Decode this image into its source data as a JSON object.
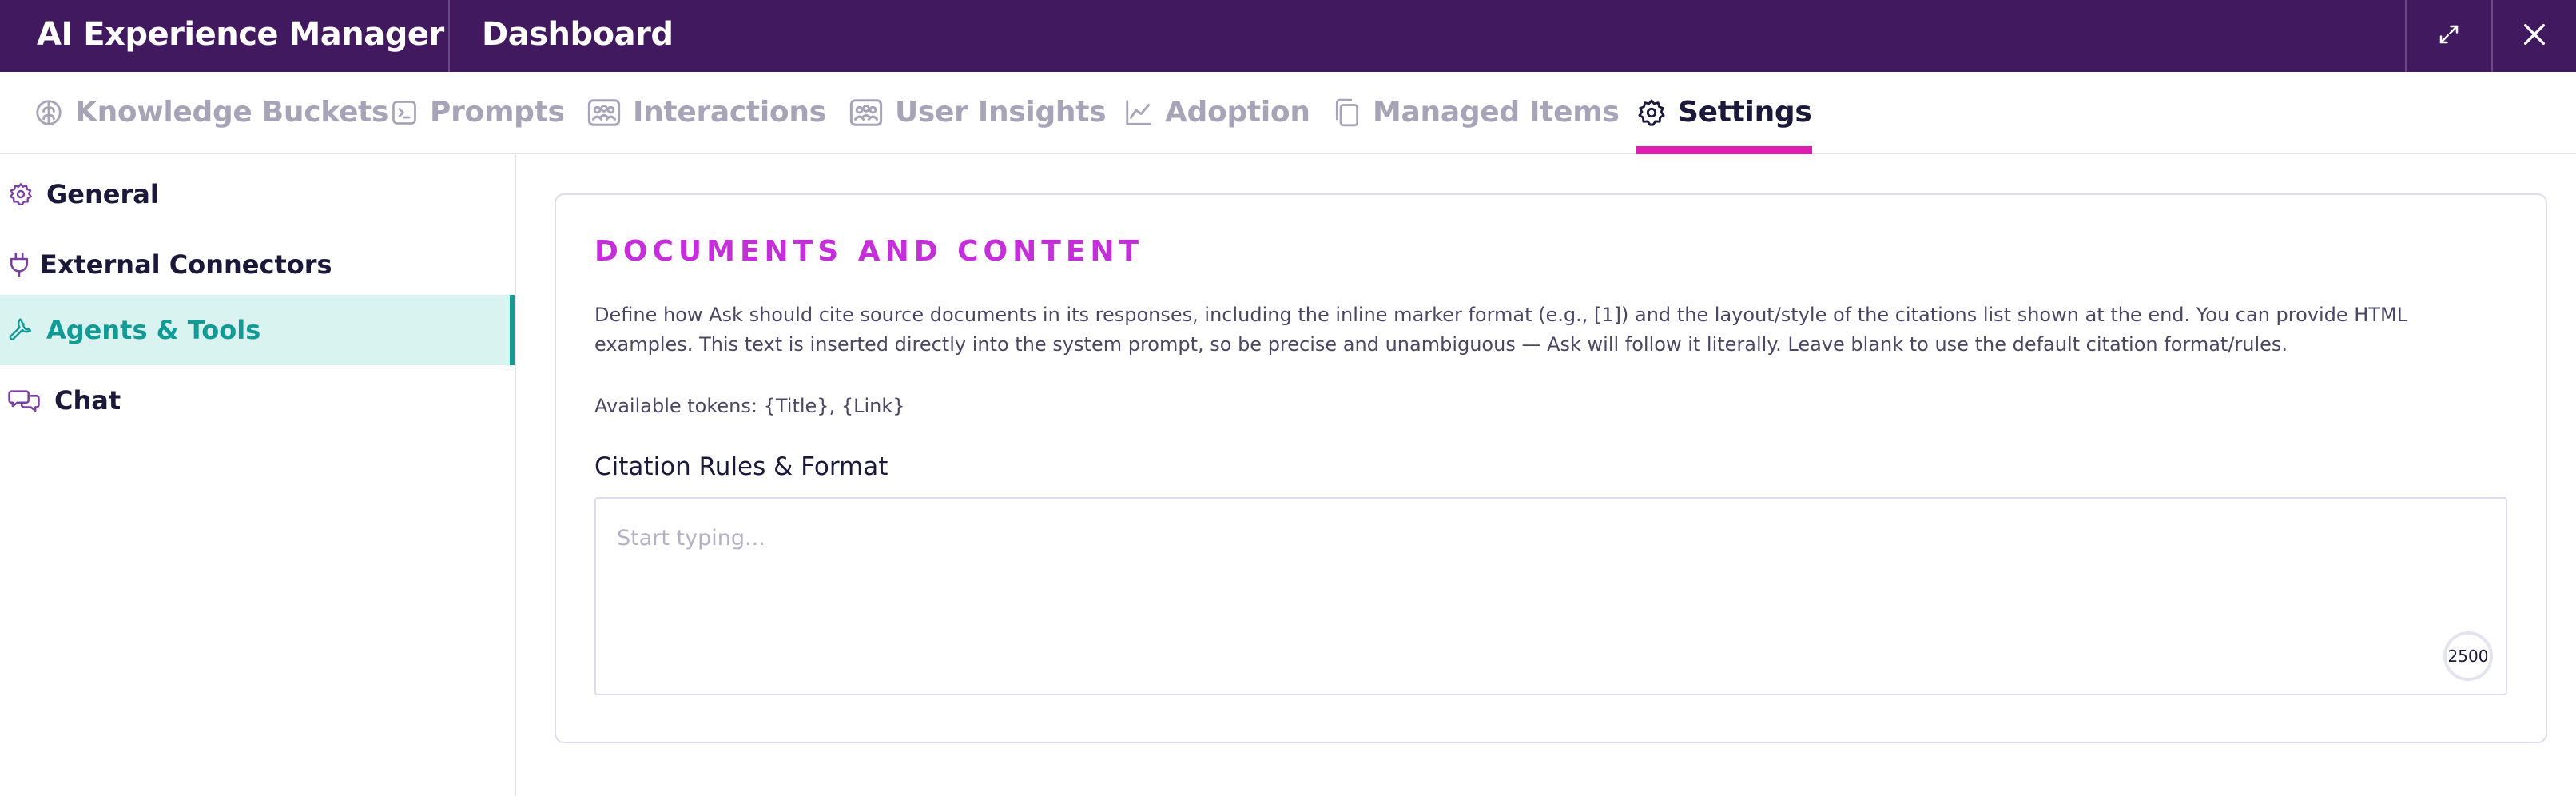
{
  "header": {
    "app_title": "AI Experience Manager",
    "page_title": "Dashboard",
    "expand_icon": "expand-arrows-icon",
    "close_icon": "close-icon",
    "background_color": "#41195e"
  },
  "tabs": [
    {
      "label": "Knowledge Buckets",
      "icon": "brain-icon",
      "active": false
    },
    {
      "label": "Prompts",
      "icon": "terminal-icon",
      "active": false
    },
    {
      "label": "Interactions",
      "icon": "people-board-icon",
      "active": false
    },
    {
      "label": "User Insights",
      "icon": "people-board-icon",
      "active": false
    },
    {
      "label": "Adoption",
      "icon": "line-chart-icon",
      "active": false
    },
    {
      "label": "Managed Items",
      "icon": "copy-icon",
      "active": false
    },
    {
      "label": "Settings",
      "icon": "gear-icon",
      "active": true
    }
  ],
  "sidebar": {
    "items": [
      {
        "label": "General",
        "icon": "gear-icon",
        "active": false
      },
      {
        "label": "External Connectors",
        "icon": "plug-icon",
        "active": false
      },
      {
        "label": "Agents & Tools",
        "icon": "wrench-icon",
        "active": true
      },
      {
        "label": "Chat",
        "icon": "chat-bubbles-icon",
        "active": false
      }
    ]
  },
  "section": {
    "heading": "DOCUMENTS AND CONTENT",
    "description": "Define how Ask should cite source documents in its responses, including the inline marker format (e.g., [1]) and the layout/style of the citations list shown at the end. You can provide HTML examples. This text is inserted directly into the system prompt, so be precise and unambiguous — Ask will follow it literally. Leave blank to use the default citation format/rules.",
    "tokens": "Available tokens: {Title}, {Link}",
    "field_label": "Citation Rules & Format",
    "field_value": "",
    "field_placeholder": "Start typing...",
    "char_limit": "2500"
  },
  "colors": {
    "accent_tab_underline": "#dc1fb0",
    "heading": "#c42fd9",
    "sidebar_active": "#139a94",
    "sidebar_active_bg": "#d8f3f0"
  }
}
